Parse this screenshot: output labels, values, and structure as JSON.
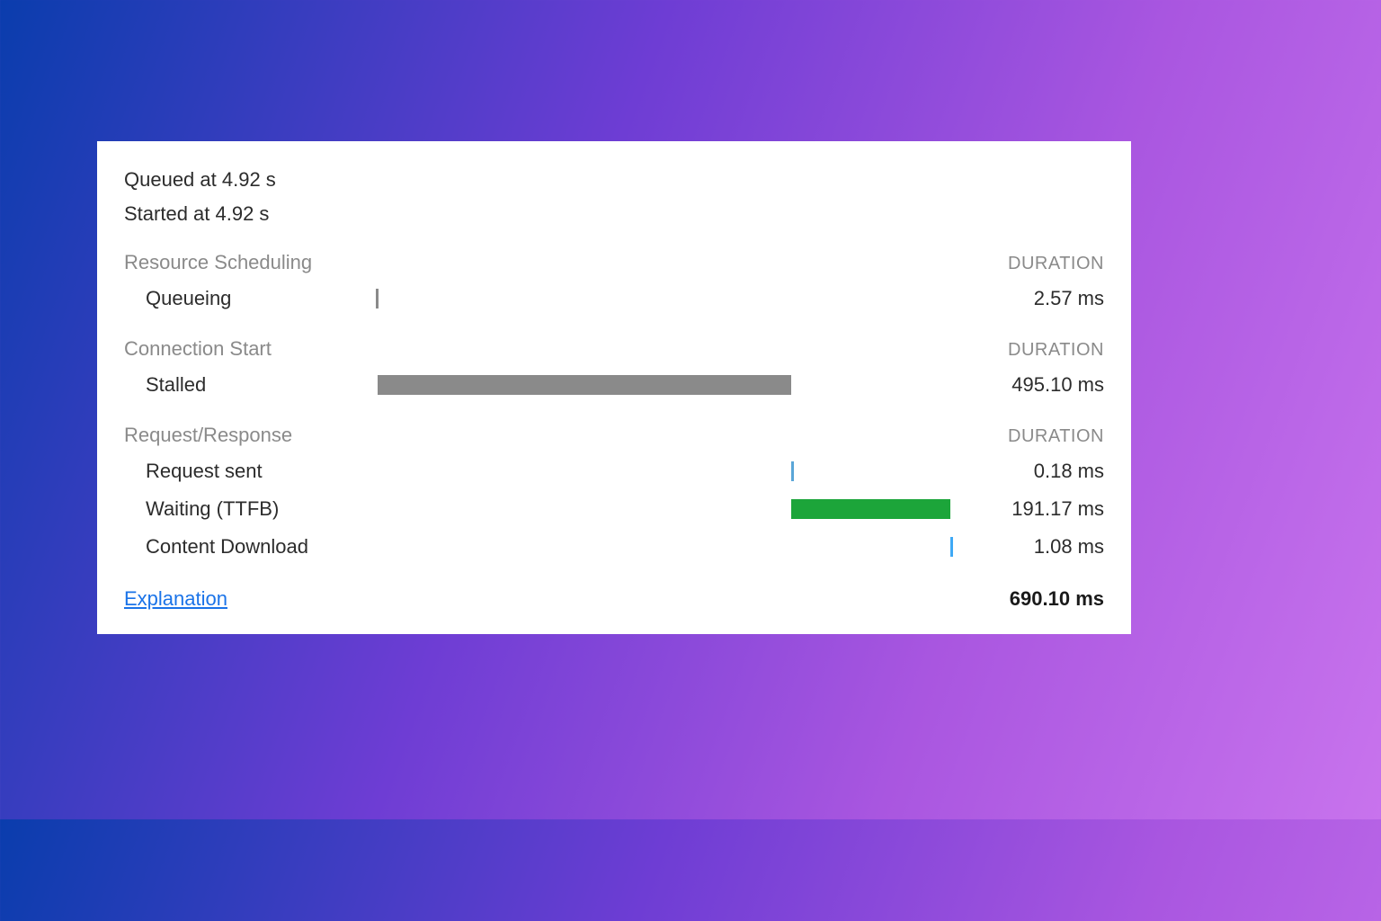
{
  "meta": {
    "queued_at": "Queued at 4.92 s",
    "started_at": "Started at 4.92 s"
  },
  "sections": {
    "resource_scheduling": {
      "title": "Resource Scheduling",
      "duration_head": "DURATION",
      "queueing": {
        "label": "Queueing",
        "value": "2.57 ms"
      }
    },
    "connection_start": {
      "title": "Connection Start",
      "duration_head": "DURATION",
      "stalled": {
        "label": "Stalled",
        "value": "495.10 ms"
      }
    },
    "request_response": {
      "title": "Request/Response",
      "duration_head": "DURATION",
      "request_sent": {
        "label": "Request sent",
        "value": "0.18 ms"
      },
      "waiting_ttfb": {
        "label": "Waiting (TTFB)",
        "value": "191.17 ms"
      },
      "content_download": {
        "label": "Content Download",
        "value": "1.08 ms"
      }
    }
  },
  "footer": {
    "explanation": "Explanation",
    "total": "690.10 ms"
  },
  "chart_data": {
    "type": "bar",
    "orientation": "horizontal-stacked-timeline",
    "total_ms": 690.1,
    "phases": [
      {
        "name": "Queueing",
        "start_ms": 0.0,
        "duration_ms": 2.57,
        "color": "#8a8a8a"
      },
      {
        "name": "Stalled",
        "start_ms": 2.57,
        "duration_ms": 495.1,
        "color": "#8a8a8a"
      },
      {
        "name": "Request sent",
        "start_ms": 497.67,
        "duration_ms": 0.18,
        "color": "#5aa6d8"
      },
      {
        "name": "Waiting (TTFB)",
        "start_ms": 497.85,
        "duration_ms": 191.17,
        "color": "#1ca53a"
      },
      {
        "name": "Content Download",
        "start_ms": 689.02,
        "duration_ms": 1.08,
        "color": "#3fa9f5"
      }
    ]
  }
}
